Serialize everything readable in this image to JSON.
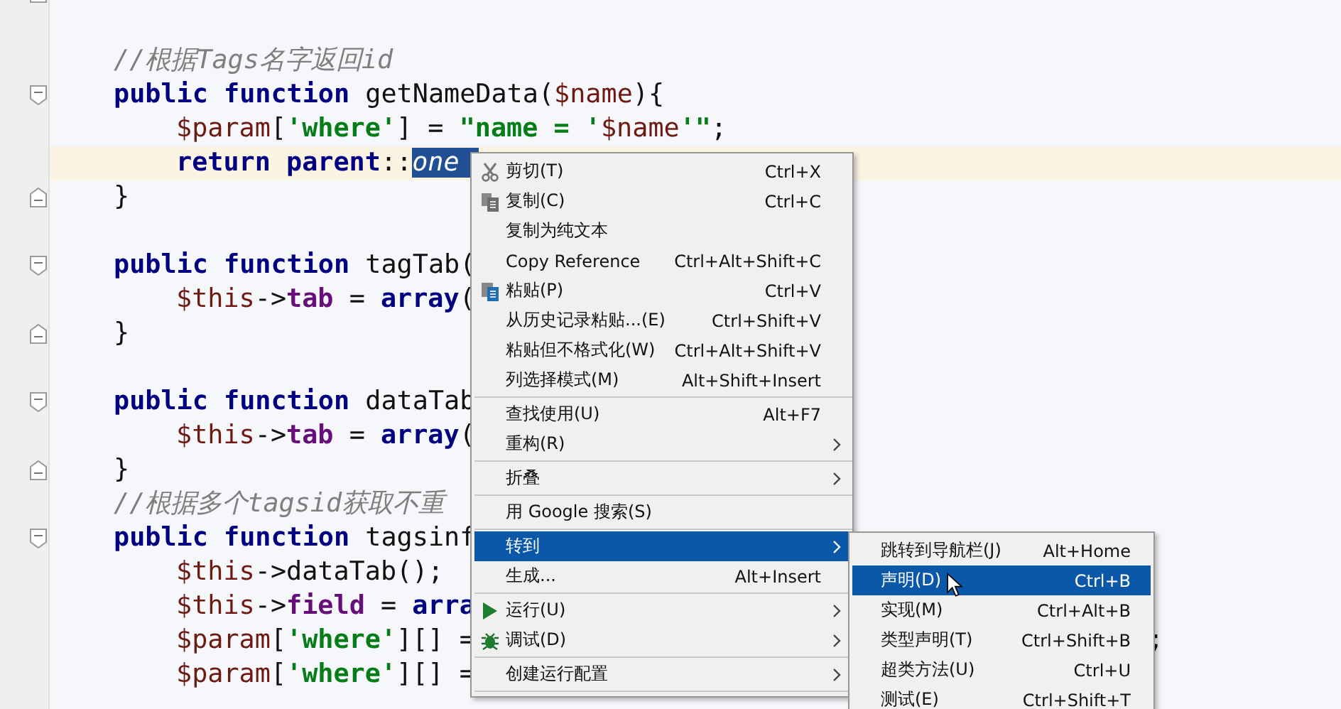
{
  "editor": {
    "lines": [
      {
        "kind": "outer",
        "current": false,
        "fold_start": false,
        "fold_end": true
      },
      {
        "kind": "outer",
        "current": false,
        "fold_start": false,
        "fold_end": false
      },
      {
        "kind": "outer",
        "current": false,
        "fold_start": false,
        "fold_end": false,
        "tokens": [
          {
            "kind": "comment",
            "text": "//根据Tags名字返回id"
          }
        ]
      },
      {
        "kind": "outer",
        "current": false,
        "fold_start": true,
        "fold_end": false,
        "tokens": [
          {
            "kind": "kw",
            "text": "public function "
          },
          {
            "kind": "plain",
            "text": "getNameData("
          },
          {
            "kind": "var",
            "text": "$name"
          },
          {
            "kind": "plain",
            "text": "){"
          }
        ]
      },
      {
        "kind": "inner",
        "current": false,
        "fold_start": false,
        "fold_end": false,
        "tokens": [
          {
            "kind": "var",
            "text": "$param"
          },
          {
            "kind": "plain",
            "text": "["
          },
          {
            "kind": "str",
            "text": "'where'"
          },
          {
            "kind": "plain",
            "text": "] = "
          },
          {
            "kind": "str",
            "text": "\"name = '"
          },
          {
            "kind": "var",
            "text": "$name"
          },
          {
            "kind": "str",
            "text": "'\""
          },
          {
            "kind": "plain",
            "text": ";"
          }
        ]
      },
      {
        "kind": "inner",
        "current": true,
        "fold_start": false,
        "fold_end": false,
        "tokens": [
          {
            "kind": "kw",
            "text": "return parent"
          },
          {
            "kind": "plain",
            "text": "::"
          },
          {
            "kind": "sel",
            "text": "one"
          }
        ]
      },
      {
        "kind": "outer",
        "current": false,
        "fold_start": false,
        "fold_end": true,
        "tokens": [
          {
            "kind": "plain",
            "text": "}"
          }
        ]
      },
      {
        "kind": "outer",
        "current": false,
        "fold_start": false,
        "fold_end": false
      },
      {
        "kind": "outer",
        "current": false,
        "fold_start": true,
        "fold_end": false,
        "tokens": [
          {
            "kind": "kw",
            "text": "public function "
          },
          {
            "kind": "plain",
            "text": "tagTab("
          }
        ]
      },
      {
        "kind": "inner",
        "current": false,
        "fold_start": false,
        "fold_end": false,
        "tokens": [
          {
            "kind": "var",
            "text": "$this"
          },
          {
            "kind": "plain",
            "text": "->"
          },
          {
            "kind": "prop",
            "text": "tab"
          },
          {
            "kind": "plain",
            "text": " = "
          },
          {
            "kind": "kw",
            "text": "array"
          },
          {
            "kind": "plain",
            "text": "("
          }
        ]
      },
      {
        "kind": "outer",
        "current": false,
        "fold_start": false,
        "fold_end": true,
        "tokens": [
          {
            "kind": "plain",
            "text": "}"
          }
        ]
      },
      {
        "kind": "outer",
        "current": false,
        "fold_start": false,
        "fold_end": false
      },
      {
        "kind": "outer",
        "current": false,
        "fold_start": true,
        "fold_end": false,
        "tokens": [
          {
            "kind": "kw",
            "text": "public function "
          },
          {
            "kind": "plain",
            "text": "dataTab"
          }
        ]
      },
      {
        "kind": "inner",
        "current": false,
        "fold_start": false,
        "fold_end": false,
        "tokens": [
          {
            "kind": "var",
            "text": "$this"
          },
          {
            "kind": "plain",
            "text": "->"
          },
          {
            "kind": "prop",
            "text": "tab"
          },
          {
            "kind": "plain",
            "text": " = "
          },
          {
            "kind": "kw",
            "text": "array"
          },
          {
            "kind": "plain",
            "text": "("
          }
        ]
      },
      {
        "kind": "outer",
        "current": false,
        "fold_start": false,
        "fold_end": true,
        "tokens": [
          {
            "kind": "plain",
            "text": "}"
          }
        ]
      },
      {
        "kind": "outer",
        "current": false,
        "fold_start": false,
        "fold_end": false,
        "tokens": [
          {
            "kind": "comment",
            "text": "//根据多个tagsid获取不重"
          }
        ]
      },
      {
        "kind": "outer",
        "current": false,
        "fold_start": true,
        "fold_end": false,
        "tokens": [
          {
            "kind": "kw",
            "text": "public function "
          },
          {
            "kind": "plain",
            "text": "tagsinf"
          }
        ]
      },
      {
        "kind": "inner",
        "current": false,
        "fold_start": false,
        "fold_end": false,
        "tokens": [
          {
            "kind": "var",
            "text": "$this"
          },
          {
            "kind": "plain",
            "text": "->dataTab();"
          }
        ]
      },
      {
        "kind": "inner",
        "current": false,
        "fold_start": false,
        "fold_end": false,
        "tokens": [
          {
            "kind": "var",
            "text": "$this"
          },
          {
            "kind": "plain",
            "text": "->"
          },
          {
            "kind": "prop",
            "text": "field"
          },
          {
            "kind": "plain",
            "text": " = "
          },
          {
            "kind": "kw",
            "text": "arra"
          }
        ]
      },
      {
        "kind": "inner",
        "current": false,
        "fold_start": false,
        "fold_end": false,
        "tail": ";",
        "tokens": [
          {
            "kind": "var",
            "text": "$param"
          },
          {
            "kind": "plain",
            "text": "["
          },
          {
            "kind": "str",
            "text": "'where'"
          },
          {
            "kind": "plain",
            "text": "][] ="
          }
        ]
      },
      {
        "kind": "inner",
        "current": false,
        "fold_start": false,
        "fold_end": false,
        "tokens": [
          {
            "kind": "var",
            "text": "$param"
          },
          {
            "kind": "plain",
            "text": "["
          },
          {
            "kind": "str",
            "text": "'where'"
          },
          {
            "kind": "plain",
            "text": "][] ="
          }
        ]
      }
    ]
  },
  "context_menu": {
    "items": [
      {
        "kind": "cut",
        "label": "剪切(T)",
        "shortcut": "Ctrl+X",
        "submenu": false,
        "selected": false
      },
      {
        "kind": "copy",
        "label": "复制(C)",
        "shortcut": "Ctrl+C",
        "submenu": false,
        "selected": false
      },
      {
        "kind": "item",
        "label": "复制为纯文本",
        "submenu": false,
        "selected": false
      },
      {
        "kind": "item",
        "label": "Copy Reference",
        "shortcut": "Ctrl+Alt+Shift+C",
        "submenu": false,
        "selected": false
      },
      {
        "kind": "paste",
        "label": "粘贴(P)",
        "shortcut": "Ctrl+V",
        "submenu": false,
        "selected": false
      },
      {
        "kind": "item",
        "label": "从历史记录粘贴...(E)",
        "shortcut": "Ctrl+Shift+V",
        "submenu": false,
        "selected": false
      },
      {
        "kind": "item",
        "label": "粘贴但不格式化(W)",
        "shortcut": "Ctrl+Alt+Shift+V",
        "submenu": false,
        "selected": false
      },
      {
        "kind": "item",
        "label": "列选择模式(M)",
        "shortcut": "Alt+Shift+Insert",
        "submenu": false,
        "selected": false
      },
      {
        "kind": "separator"
      },
      {
        "kind": "item",
        "label": "查找使用(U)",
        "shortcut": "Alt+F7",
        "submenu": false,
        "selected": false
      },
      {
        "kind": "item",
        "label": "重构(R)",
        "submenu": true,
        "selected": false
      },
      {
        "kind": "separator"
      },
      {
        "kind": "item",
        "label": "折叠",
        "submenu": true,
        "selected": false
      },
      {
        "kind": "separator"
      },
      {
        "kind": "item",
        "label": "用 Google 搜索(S)",
        "submenu": false,
        "selected": false
      },
      {
        "kind": "separator"
      },
      {
        "kind": "item",
        "label": "转到",
        "submenu": true,
        "selected": true
      },
      {
        "kind": "item",
        "label": "生成...",
        "shortcut": "Alt+Insert",
        "submenu": false,
        "selected": false
      },
      {
        "kind": "separator"
      },
      {
        "kind": "run",
        "label": "运行(U)",
        "submenu": true,
        "selected": false
      },
      {
        "kind": "debug",
        "label": "调试(D)",
        "submenu": true,
        "selected": false
      },
      {
        "kind": "separator"
      },
      {
        "kind": "item",
        "label": "创建运行配置",
        "submenu": true,
        "selected": false
      },
      {
        "kind": "separator"
      }
    ]
  },
  "submenu": {
    "items": [
      {
        "label": "跳转到导航栏(J)",
        "shortcut": "Alt+Home",
        "selected": false
      },
      {
        "label": "声明(D)",
        "shortcut": "Ctrl+B",
        "selected": true
      },
      {
        "label": "实现(M)",
        "shortcut": "Ctrl+Alt+B",
        "selected": false
      },
      {
        "label": "类型声明(T)",
        "shortcut": "Ctrl+Shift+B",
        "selected": false
      },
      {
        "label": "超类方法(U)",
        "shortcut": "Ctrl+U",
        "selected": false
      },
      {
        "label": "测试(E)",
        "shortcut": "Ctrl+Shift+T",
        "selected": false
      }
    ]
  }
}
